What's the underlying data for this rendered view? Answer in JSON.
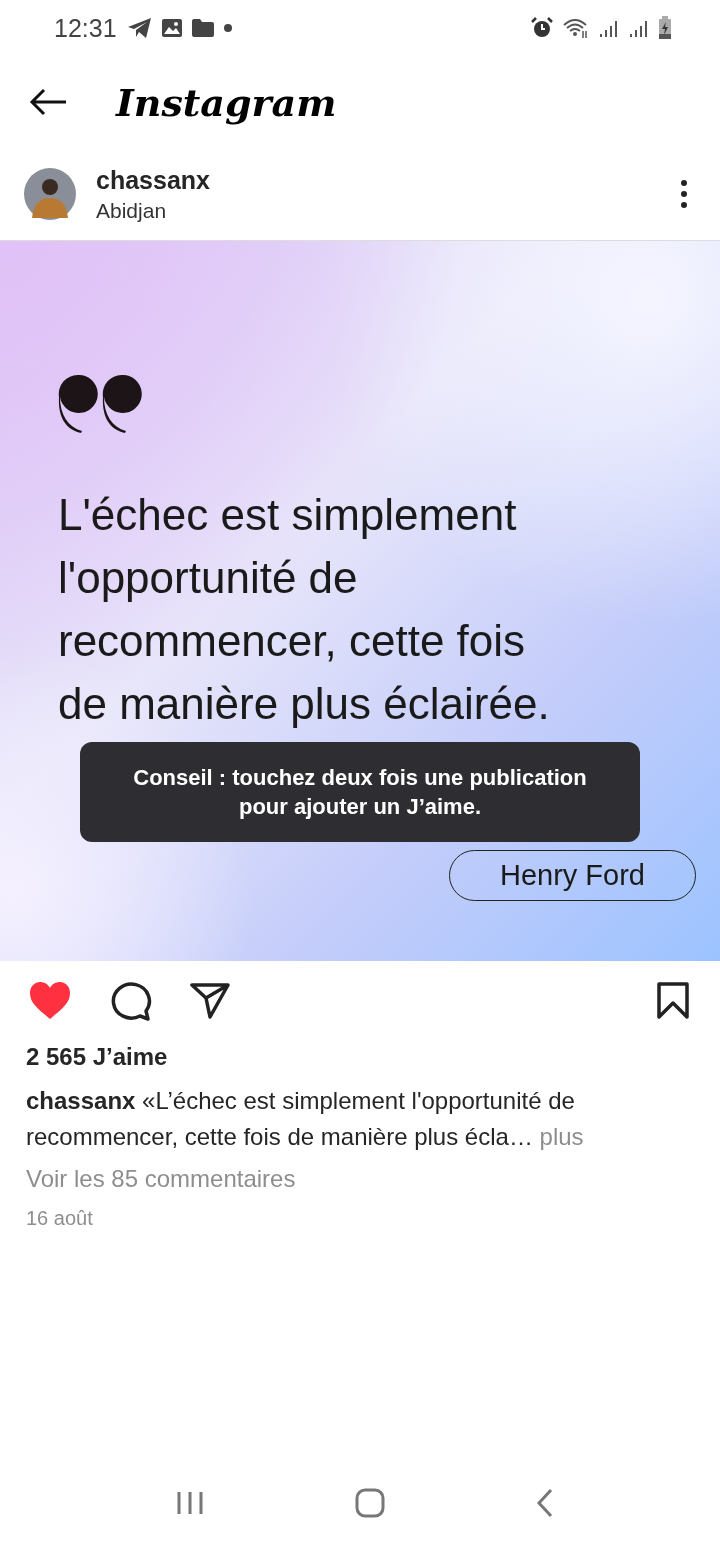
{
  "status_bar": {
    "time": "12:31"
  },
  "header": {
    "title": "Instagram"
  },
  "post": {
    "username": "chassanx",
    "location": "Abidjan",
    "quote_lines": [
      "L'échec est simplement",
      "l'opportunité de",
      "recommencer, cette fois",
      "de manière plus éclairée."
    ],
    "author": "Henry Ford",
    "toast": "Conseil : touchez deux fois une publication pour ajouter un J’aime.",
    "liked": true,
    "saved": false,
    "likes": "2 565 J’aime",
    "caption_user": "chassanx",
    "caption": "«L’échec est simplement l'opportunité de recommencer, cette fois de manière plus écla…",
    "more": "plus",
    "comments": "Voir les 85 commentaires",
    "date": "16 août"
  }
}
